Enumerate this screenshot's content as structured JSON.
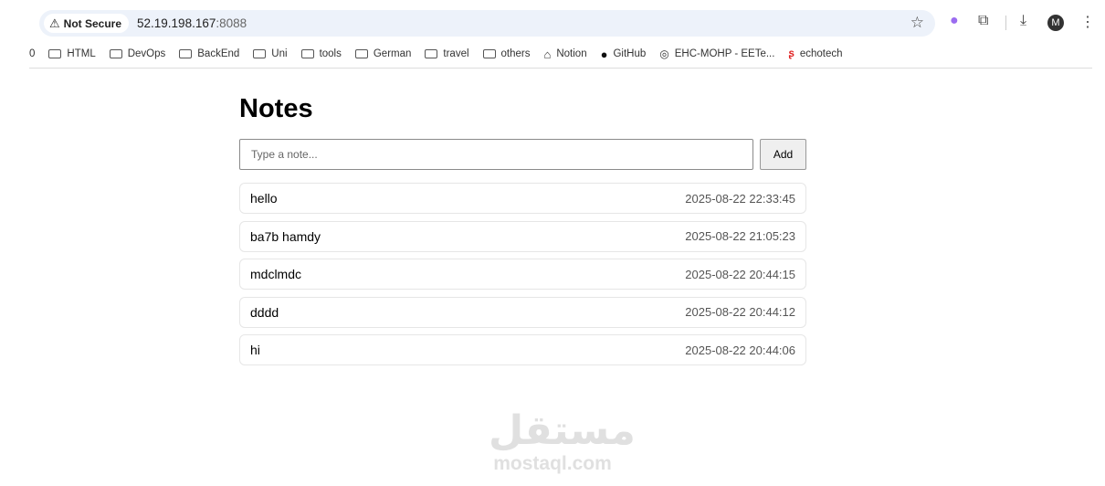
{
  "browser": {
    "security_label": "Not Secure",
    "url_host": "52.19.198.167",
    "url_port": ":8088",
    "avatar_initial": "M",
    "bookmarks": [
      {
        "label": "0",
        "icon": "none"
      },
      {
        "label": "HTML",
        "icon": "folder-icon"
      },
      {
        "label": "DevOps",
        "icon": "folder-icon"
      },
      {
        "label": "BackEnd",
        "icon": "folder-icon"
      },
      {
        "label": "Uni",
        "icon": "folder-icon"
      },
      {
        "label": "tools",
        "icon": "folder-icon"
      },
      {
        "label": "German",
        "icon": "folder-icon"
      },
      {
        "label": "travel",
        "icon": "folder-icon"
      },
      {
        "label": "others",
        "icon": "folder-icon"
      },
      {
        "label": "Notion",
        "icon": "notion-icon"
      },
      {
        "label": "GitHub",
        "icon": "github-icon"
      },
      {
        "label": "EHC-MOHP - EETe...",
        "icon": "site-icon"
      },
      {
        "label": "echotech",
        "icon": "echotech-icon"
      }
    ]
  },
  "page": {
    "title": "Notes",
    "input_placeholder": "Type a note...",
    "add_label": "Add",
    "notes": [
      {
        "text": "hello",
        "date": "2025-08-22 22:33:45"
      },
      {
        "text": "ba7b hamdy",
        "date": "2025-08-22 21:05:23"
      },
      {
        "text": "mdclmdc",
        "date": "2025-08-22 20:44:15"
      },
      {
        "text": "dddd",
        "date": "2025-08-22 20:44:12"
      },
      {
        "text": "hi",
        "date": "2025-08-22 20:44:06"
      }
    ]
  },
  "watermark": {
    "arabic": "مستقل",
    "latin": "mostaql.com"
  }
}
